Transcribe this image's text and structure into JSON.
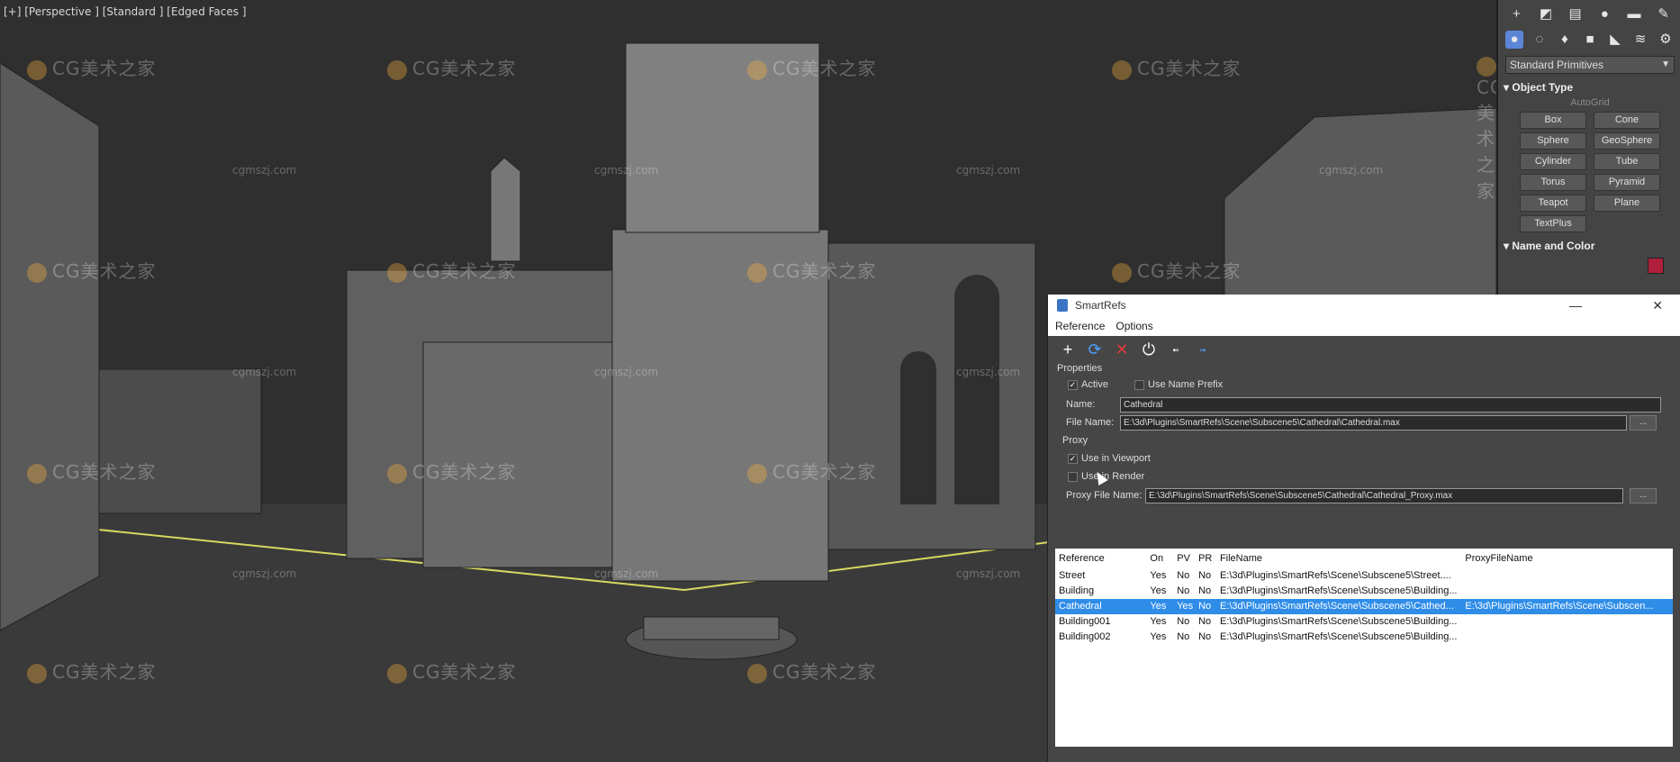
{
  "viewport": {
    "label": "[+] [Perspective ] [Standard ] [Edged Faces ]"
  },
  "watermarks": {
    "brand": "CG美术之家",
    "site": "cgmszj.com"
  },
  "command_panel": {
    "dropdown": "Standard Primitives",
    "object_type_header": "Object Type",
    "autogrid": "AutoGrid",
    "buttons": [
      "Box",
      "Cone",
      "Sphere",
      "GeoSphere",
      "Cylinder",
      "Tube",
      "Torus",
      "Pyramid",
      "Teapot",
      "Plane",
      "TextPlus"
    ],
    "name_color_header": "Name and Color",
    "color": "#b0203c"
  },
  "dialog": {
    "title": "SmartRefs",
    "menu": [
      "Reference",
      "Options"
    ],
    "toolbar_icons": [
      "add-icon",
      "refresh-icon",
      "delete-icon",
      "power-icon",
      "move-up-icon",
      "move-down-icon"
    ],
    "properties_header": "Properties",
    "active_label": "Active",
    "active_checked": true,
    "use_name_prefix_label": "Use Name Prefix",
    "use_name_prefix_checked": false,
    "name_label": "Name:",
    "name_value": "Cathedral",
    "file_name_label": "File Name:",
    "file_name_value": "E:\\3d\\Plugins\\SmartRefs\\Scene\\Subscene5\\Cathedral\\Cathedral.max",
    "browse_label": "...",
    "proxy_header": "Proxy",
    "use_in_viewport_label": "Use in Viewport",
    "use_in_viewport_checked": true,
    "use_in_render_label": "Use in Render",
    "use_in_render_checked": false,
    "proxy_file_label": "Proxy File Name:",
    "proxy_file_value": "E:\\3d\\Plugins\\SmartRefs\\Scene\\Subscene5\\Cathedral\\Cathedral_Proxy.max",
    "table": {
      "headers": [
        "Reference",
        "On",
        "PV",
        "PR",
        "FileName",
        "ProxyFileName"
      ],
      "rows": [
        {
          "ref": "Street",
          "on": "Yes",
          "pv": "No",
          "pr": "No",
          "file": "E:\\3d\\Plugins\\SmartRefs\\Scene\\Subscene5\\Street....",
          "proxy": "",
          "selected": false
        },
        {
          "ref": "Building",
          "on": "Yes",
          "pv": "No",
          "pr": "No",
          "file": "E:\\3d\\Plugins\\SmartRefs\\Scene\\Subscene5\\Building...",
          "proxy": "",
          "selected": false
        },
        {
          "ref": "Cathedral",
          "on": "Yes",
          "pv": "Yes",
          "pr": "No",
          "file": "E:\\3d\\Plugins\\SmartRefs\\Scene\\Subscene5\\Cathed...",
          "proxy": "E:\\3d\\Plugins\\SmartRefs\\Scene\\Subscen...",
          "selected": true
        },
        {
          "ref": "Building001",
          "on": "Yes",
          "pv": "No",
          "pr": "No",
          "file": "E:\\3d\\Plugins\\SmartRefs\\Scene\\Subscene5\\Building...",
          "proxy": "",
          "selected": false
        },
        {
          "ref": "Building002",
          "on": "Yes",
          "pv": "No",
          "pr": "No",
          "file": "E:\\3d\\Plugins\\SmartRefs\\Scene\\Subscene5\\Building...",
          "proxy": "",
          "selected": false
        }
      ]
    }
  }
}
